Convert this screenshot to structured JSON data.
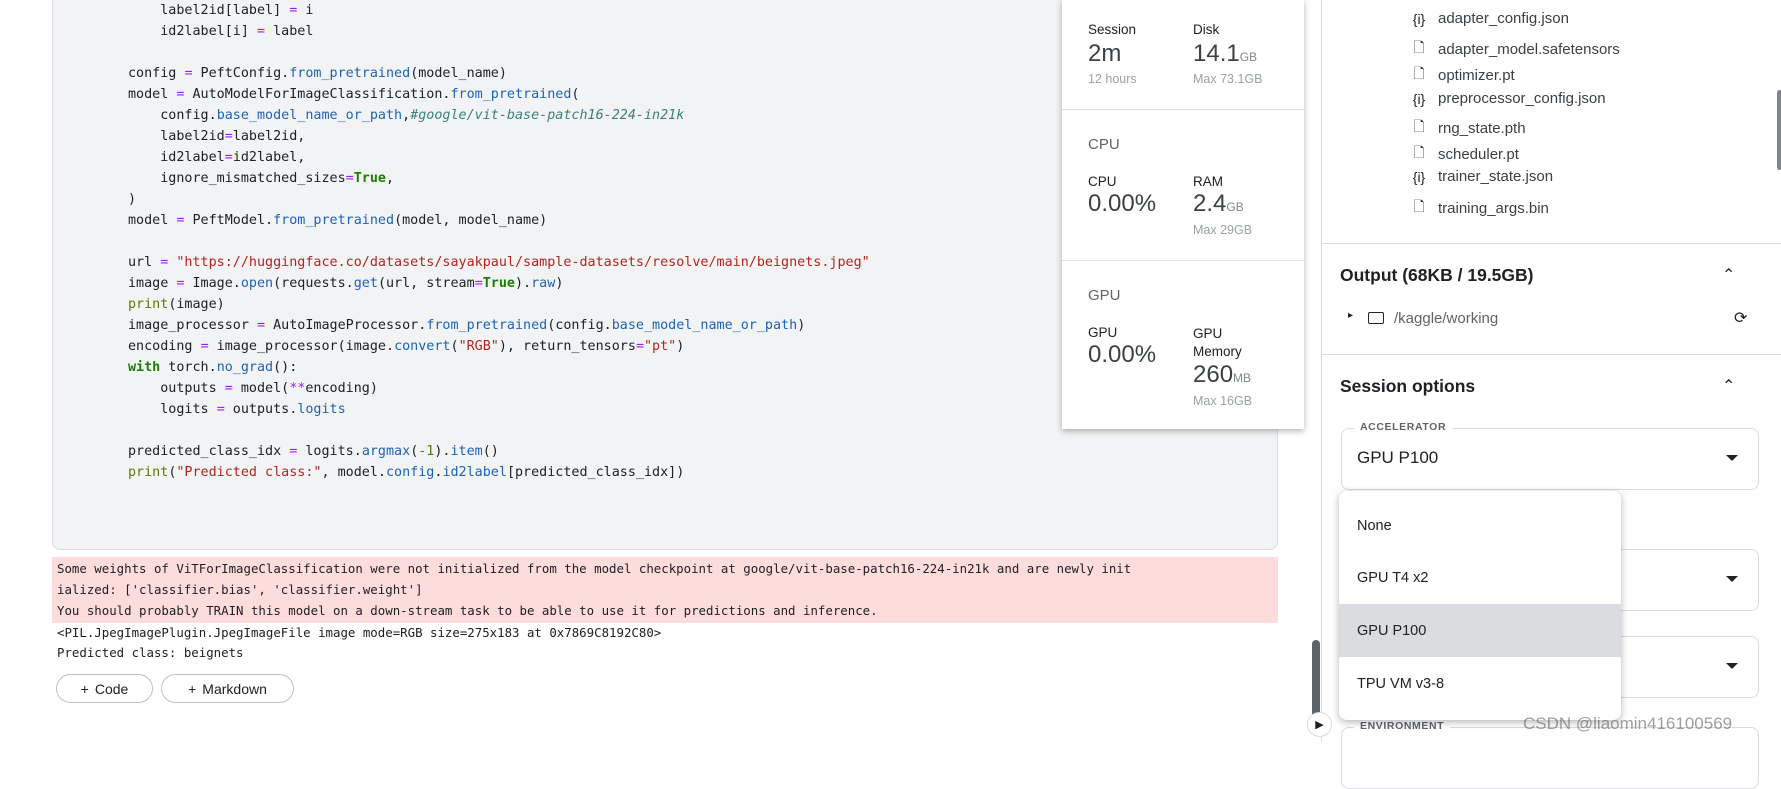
{
  "code_lines": [
    [
      [
        "    label2id[label] ",
        ""
      ],
      [
        "=",
        "o"
      ],
      [
        " i",
        ""
      ]
    ],
    [
      [
        "    id2label[i] ",
        ""
      ],
      [
        "=",
        "o"
      ],
      [
        " label",
        ""
      ]
    ],
    [],
    [
      [
        "config ",
        ""
      ],
      [
        "=",
        "o"
      ],
      [
        " PeftConfig.",
        ""
      ],
      [
        "from_pretrained",
        "f"
      ],
      [
        "(model_name)",
        ""
      ]
    ],
    [
      [
        "model ",
        ""
      ],
      [
        "=",
        "o"
      ],
      [
        " AutoModelForImageClassification.",
        ""
      ],
      [
        "from_pretrained",
        "f"
      ],
      [
        "(",
        ""
      ]
    ],
    [
      [
        "    config.",
        ""
      ],
      [
        "base_model_name_or_path",
        "f"
      ],
      [
        ",",
        ""
      ],
      [
        "#google/vit-base-patch16-224-in21k",
        "c"
      ]
    ],
    [
      [
        "    label2id",
        ""
      ],
      [
        "=",
        "o"
      ],
      [
        "label2id,",
        ""
      ]
    ],
    [
      [
        "    id2label",
        ""
      ],
      [
        "=",
        "o"
      ],
      [
        "id2label,",
        ""
      ]
    ],
    [
      [
        "    ignore_mismatched_sizes",
        ""
      ],
      [
        "=",
        "o"
      ],
      [
        "True",
        "k"
      ],
      [
        ",",
        ""
      ]
    ],
    [
      [
        ")",
        ""
      ]
    ],
    [
      [
        "model ",
        ""
      ],
      [
        "=",
        "o"
      ],
      [
        " PeftModel.",
        ""
      ],
      [
        "from_pretrained",
        "f"
      ],
      [
        "(model, model_name)",
        ""
      ]
    ],
    [],
    [
      [
        "url ",
        ""
      ],
      [
        "=",
        "o"
      ],
      [
        " ",
        ""
      ],
      [
        "\"https://huggingface.co/datasets/sayakpaul/sample-datasets/resolve/main/beignets.jpeg\"",
        "s"
      ]
    ],
    [
      [
        "image ",
        ""
      ],
      [
        "=",
        "o"
      ],
      [
        " Image.",
        ""
      ],
      [
        "open",
        "f"
      ],
      [
        "(requests.",
        ""
      ],
      [
        "get",
        "f"
      ],
      [
        "(url, stream",
        ""
      ],
      [
        "=",
        "o"
      ],
      [
        "True",
        "k"
      ],
      [
        ").",
        ""
      ],
      [
        "raw",
        "f"
      ],
      [
        ")",
        ""
      ]
    ],
    [
      [
        "print",
        "b"
      ],
      [
        "(image)",
        ""
      ]
    ],
    [
      [
        "image_processor ",
        ""
      ],
      [
        "=",
        "o"
      ],
      [
        " AutoImageProcessor.",
        ""
      ],
      [
        "from_pretrained",
        "f"
      ],
      [
        "(config.",
        ""
      ],
      [
        "base_model_name_or_path",
        "f"
      ],
      [
        ")",
        ""
      ]
    ],
    [
      [
        "encoding ",
        ""
      ],
      [
        "=",
        "o"
      ],
      [
        " image_processor(image.",
        ""
      ],
      [
        "convert",
        "f"
      ],
      [
        "(",
        ""
      ],
      [
        "\"RGB\"",
        "s"
      ],
      [
        "), return_tensors",
        ""
      ],
      [
        "=",
        "o"
      ],
      [
        "\"pt\"",
        "s"
      ],
      [
        ")",
        ""
      ]
    ],
    [
      [
        "with",
        "k"
      ],
      [
        " torch.",
        ""
      ],
      [
        "no_grad",
        "f"
      ],
      [
        "():",
        ""
      ]
    ],
    [
      [
        "    outputs ",
        ""
      ],
      [
        "=",
        "o"
      ],
      [
        " model(",
        ""
      ],
      [
        "**",
        "o"
      ],
      [
        "encoding)",
        ""
      ]
    ],
    [
      [
        "    logits ",
        ""
      ],
      [
        "=",
        "o"
      ],
      [
        " outputs.",
        ""
      ],
      [
        "logits",
        "f"
      ]
    ],
    [],
    [
      [
        "predicted_class_idx ",
        ""
      ],
      [
        "=",
        "o"
      ],
      [
        " logits.",
        ""
      ],
      [
        "argmax",
        "f"
      ],
      [
        "(",
        ""
      ],
      [
        "-1",
        "b"
      ],
      [
        ").",
        ""
      ],
      [
        "item",
        "f"
      ],
      [
        "()",
        ""
      ]
    ],
    [
      [
        "print",
        "b"
      ],
      [
        "(",
        ""
      ],
      [
        "\"Predicted class:\"",
        "s"
      ],
      [
        ", model.",
        ""
      ],
      [
        "config",
        "f"
      ],
      [
        ".",
        ""
      ],
      [
        "id2label",
        "f"
      ],
      [
        "[predicted_class_idx])",
        ""
      ]
    ]
  ],
  "output": {
    "stderr": [
      "Some weights of ViTForImageClassification were not initialized from the model checkpoint at google/vit-base-patch16-224-in21k and are newly init",
      "ialized: ['classifier.bias', 'classifier.weight']",
      "You should probably TRAIN this model on a down-stream task to be able to use it for predictions and inference."
    ],
    "stdout": [
      "<PIL.JpegImagePlugin.JpegImageFile image mode=RGB size=275x183 at 0x7869C8192C80>",
      "Predicted class: beignets"
    ]
  },
  "buttons": {
    "code": "Code",
    "markdown": "Markdown"
  },
  "resources": {
    "session_label": "Session",
    "session_value": "2m",
    "session_sub": "12 hours",
    "disk_label": "Disk",
    "disk_value": "14.1",
    "disk_unit": "GB",
    "disk_sub": "Max 73.1GB",
    "cpu_title": "CPU",
    "cpu_label": "CPU",
    "cpu_value": "0.00%",
    "ram_label": "RAM",
    "ram_value": "2.4",
    "ram_unit": "GB",
    "ram_sub": "Max 29GB",
    "gpu_title": "GPU",
    "gpu_label": "GPU",
    "gpu_value": "0.00%",
    "gpumem_label": "GPU Memory",
    "gpumem_value": "260",
    "gpumem_unit": "MB",
    "gpumem_sub": "Max 16GB"
  },
  "files": [
    {
      "name": "adapter_config.json",
      "icon": "json"
    },
    {
      "name": "adapter_model.safetensors",
      "icon": "file"
    },
    {
      "name": "optimizer.pt",
      "icon": "file"
    },
    {
      "name": "preprocessor_config.json",
      "icon": "json"
    },
    {
      "name": "rng_state.pth",
      "icon": "file"
    },
    {
      "name": "scheduler.pt",
      "icon": "file"
    },
    {
      "name": "trainer_state.json",
      "icon": "json"
    },
    {
      "name": "training_args.bin",
      "icon": "file"
    }
  ],
  "output_section": {
    "title": "Output (68KB / 19.5GB)",
    "folder": "/kaggle/working"
  },
  "session_options": {
    "title": "Session options",
    "accelerator_label": "ACCELERATOR",
    "accelerator_value": "GPU P100",
    "environment_label": "ENVIRONMENT",
    "options": [
      "None",
      "GPU T4 x2",
      "GPU P100",
      "TPU VM v3-8"
    ],
    "selected_index": 2
  },
  "watermark": "CSDN @liaomin416100569"
}
